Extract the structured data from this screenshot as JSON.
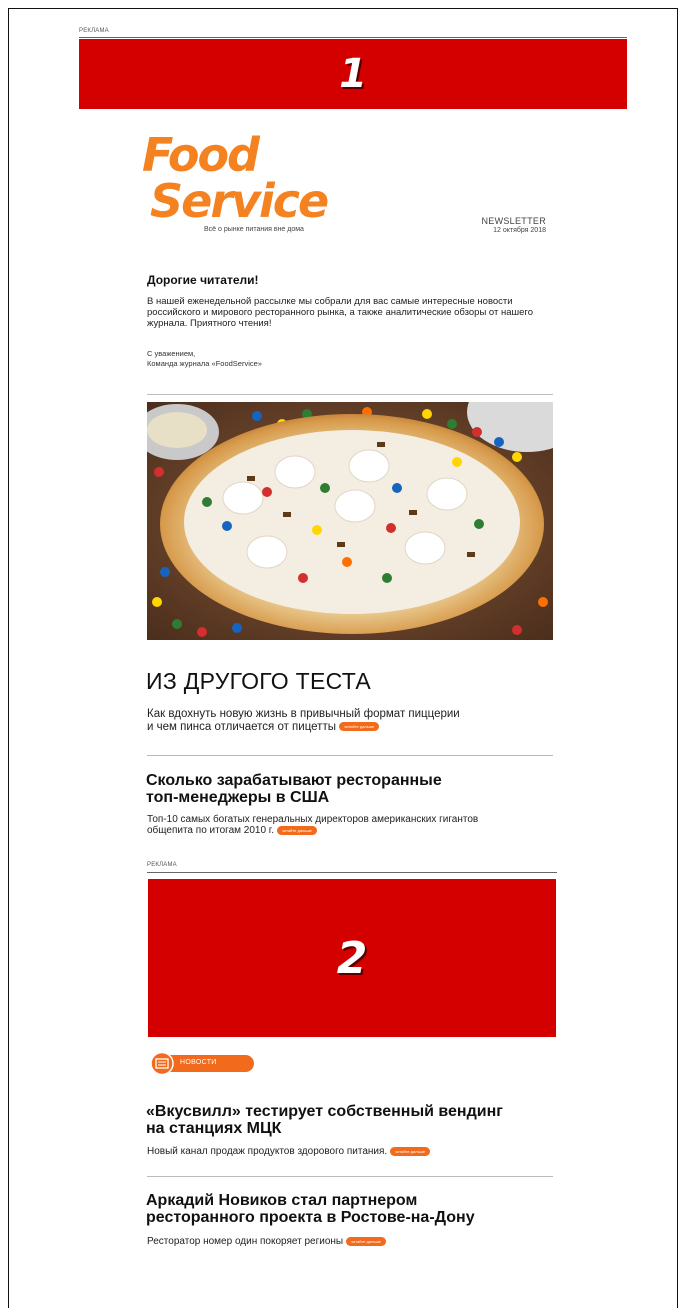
{
  "ad1": {
    "label": "РЕКЛАМА",
    "number": "1"
  },
  "logo": {
    "line1": "Food",
    "line2": "Service",
    "tagline": "Всё о рынке питания вне дома"
  },
  "newsletter": {
    "title": "NEWSLETTER",
    "date": "12 октября 2018"
  },
  "greeting": {
    "title": "Дорогие читатели!",
    "body": "В нашей еженедельной рассылке мы собрали для вас самые интересные новости российского и мирового ресторанного рынка, а также аналитические обзоры от нашего журнала. Приятного чтения!",
    "sign_line1": "С уважением,",
    "sign_line2": "Команда журнала «FoodService»"
  },
  "feature": {
    "title": "ИЗ ДРУГОГО ТЕСТА",
    "lead_line1": "Как вдохнуть новую жизнь в привычный формат пиццерии",
    "lead_line2": "и чем пинса отличается от пицетты",
    "more": "читайте дальше"
  },
  "article1": {
    "title_line1": "Сколько зарабатывают ресторанные",
    "title_line2": "топ-менеджеры в США",
    "text_line1": "Топ-10 самых богатых генеральных директоров американских гигантов",
    "text_line2": "общепита по итогам 2010 г.",
    "more": "читайте дальше"
  },
  "ad2": {
    "label": "РЕКЛАМА",
    "number": "2"
  },
  "news_tag": {
    "label": "НОВОСТИ"
  },
  "news1": {
    "title_line1": "«Вкусвилл» тестирует собственный вендинг",
    "title_line2": "на станциях МЦК",
    "text": "Новый канал продаж продуктов здорового питания.",
    "more": "читайте дальше"
  },
  "news2": {
    "title_line1": "Аркадий Новиков стал партнером",
    "title_line2": "ресторанного проекта в Ростове-на-Дону",
    "text": "Ресторатор номер один покоряет регионы",
    "more": "читайте дальше"
  },
  "colors": {
    "ad_red": "#d40000",
    "brand_orange": "#f58220",
    "pill_orange": "#f26a1b"
  }
}
